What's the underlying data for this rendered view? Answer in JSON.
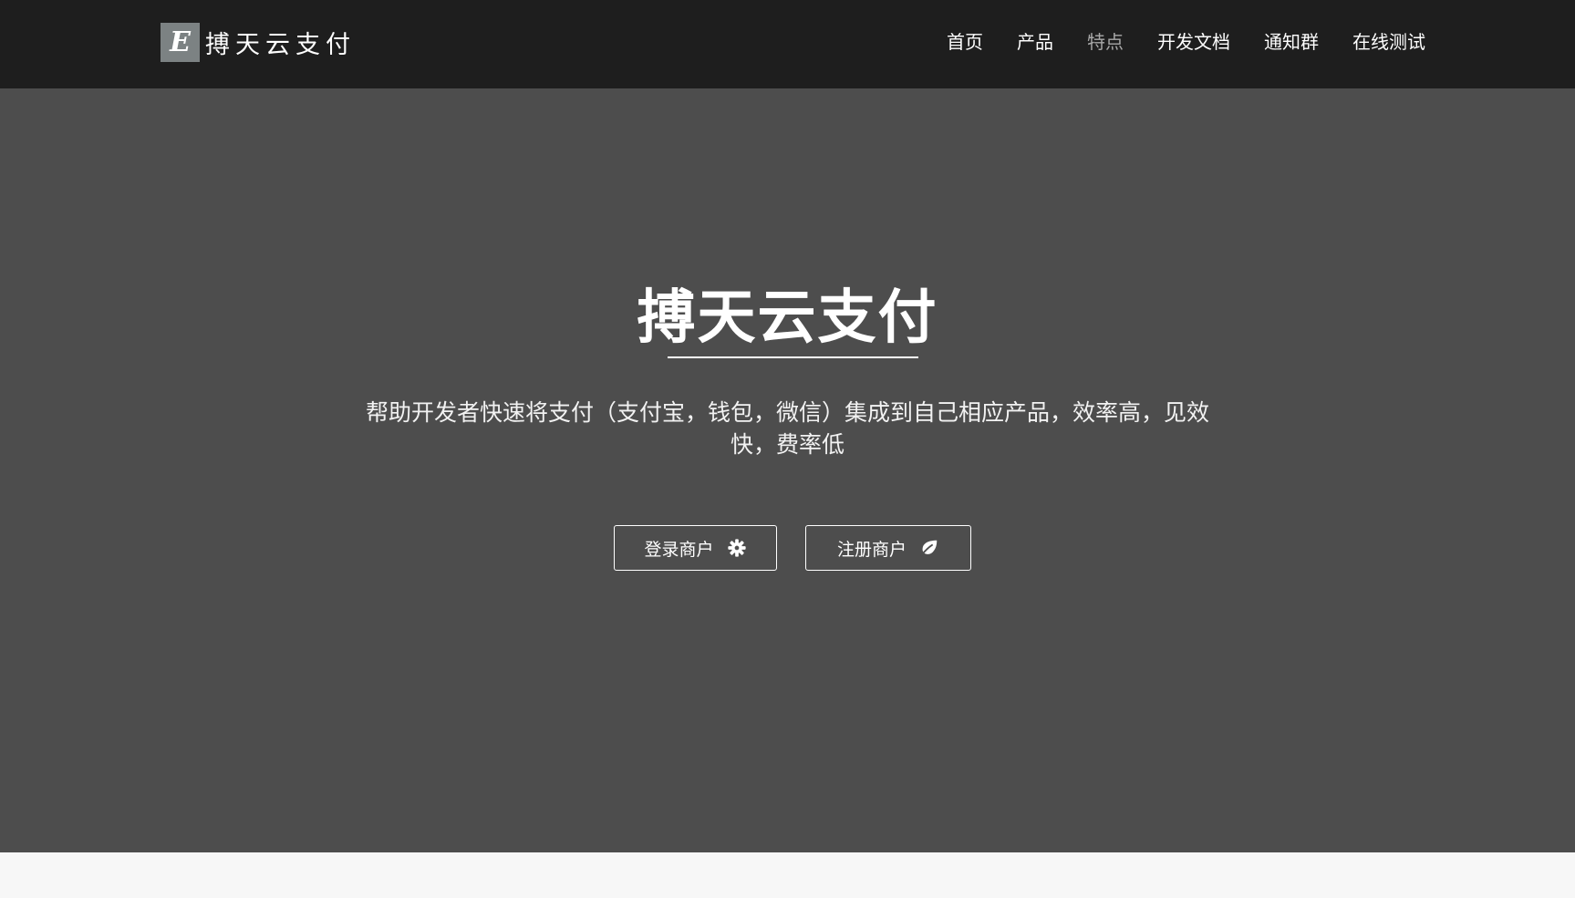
{
  "header": {
    "logo_letter": "E",
    "brand_name": "搏天云支付",
    "nav": [
      {
        "label": "首页",
        "active": false
      },
      {
        "label": "产品",
        "active": false
      },
      {
        "label": "特点",
        "active": true
      },
      {
        "label": "开发文档",
        "active": false
      },
      {
        "label": "通知群",
        "active": false
      },
      {
        "label": "在线测试",
        "active": false
      }
    ]
  },
  "hero": {
    "title": "搏天云支付",
    "tagline": "帮助开发者快速将支付（支付宝，钱包，微信）集成到自己相应产品，效率高，见效快，费率低",
    "buttons": [
      {
        "label": "登录商户",
        "icon": "gear-icon"
      },
      {
        "label": "注册商户",
        "icon": "leaf-icon"
      }
    ]
  },
  "colors": {
    "navbar_bg": "#1e1e1e",
    "hero_bg": "#4d4d4d",
    "logo_bg": "#7c8283",
    "nav_active": "#a8a8a8"
  }
}
